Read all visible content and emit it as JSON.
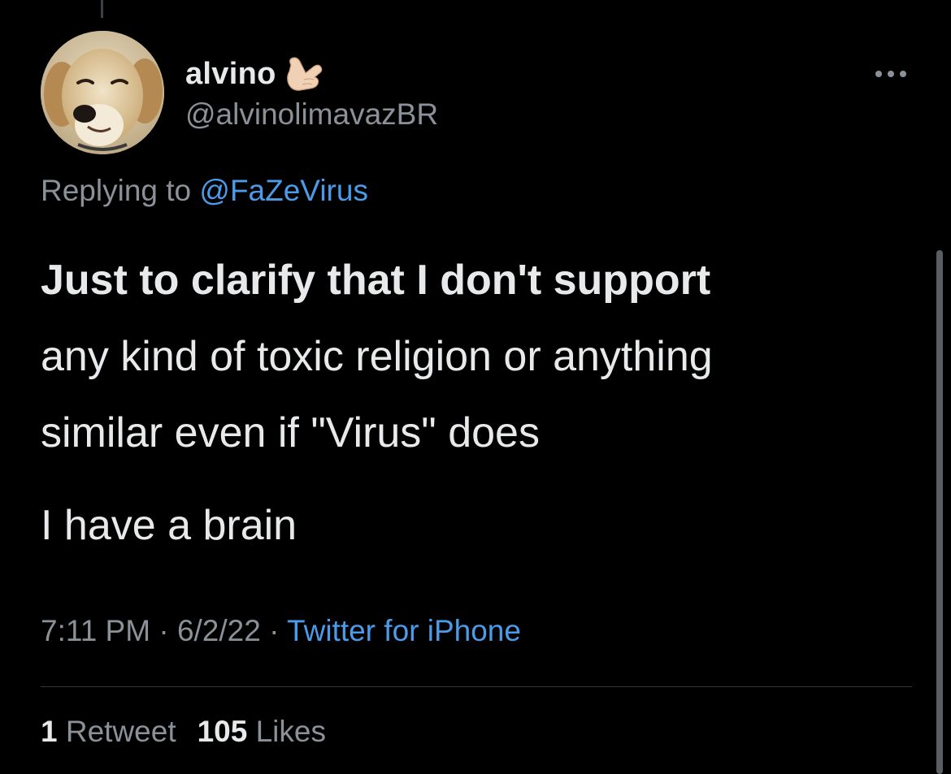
{
  "tweet": {
    "author": {
      "display_name": "alvino",
      "name_emoji_icon": "call-me-hand-icon",
      "handle": "@alvinolimavazBR",
      "avatar": "dog-avatar"
    },
    "more_icon": "more-horizontal-icon",
    "reply_prefix": "Replying to",
    "reply_to": "@FaZeVirus",
    "text_lines": [
      "Just to clarify that I don't support",
      "any kind of toxic religion or anything",
      "similar even if \"Virus\" does"
    ],
    "text_line_2": "I have a brain",
    "time": "7:11 PM",
    "date": "6/2/22",
    "separator": "·",
    "source": "Twitter for iPhone",
    "retweet_count": "1",
    "retweet_label": "Retweet",
    "like_count": "105",
    "like_label": "Likes"
  },
  "colors": {
    "background": "#000000",
    "text": "#e7e9ea",
    "secondary": "#8b9198",
    "link": "#4b9be8"
  }
}
